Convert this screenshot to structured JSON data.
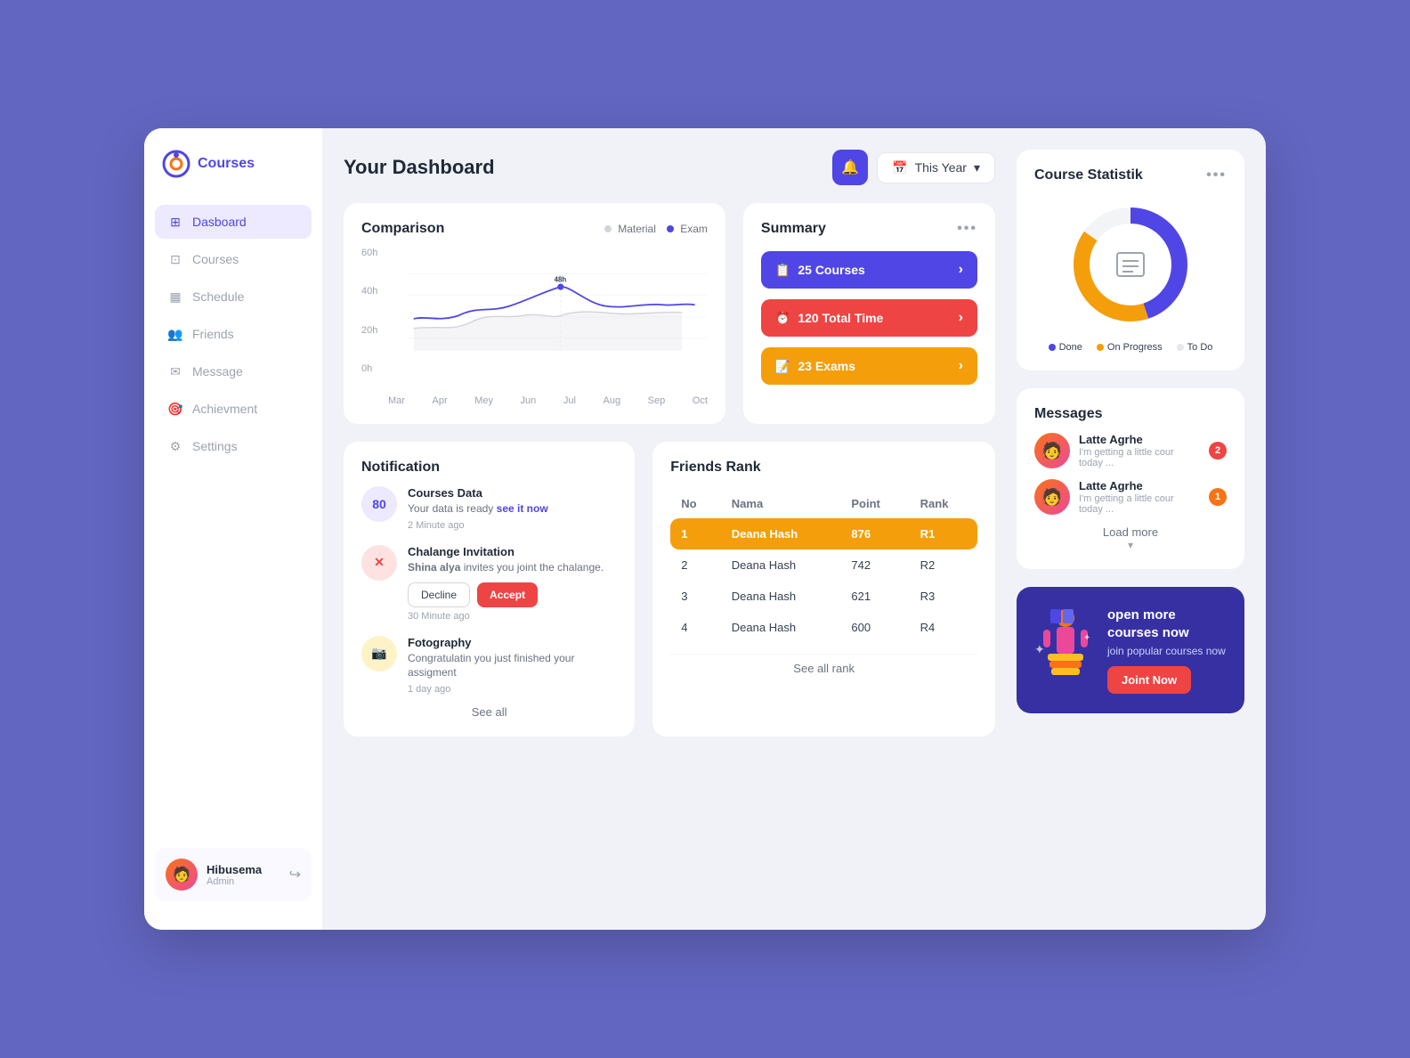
{
  "app": {
    "title": "Courses",
    "logo_alt": "Courses Logo"
  },
  "sidebar": {
    "items": [
      {
        "id": "dashboard",
        "label": "Dasboard",
        "icon": "⊞",
        "active": true
      },
      {
        "id": "courses",
        "label": "Courses",
        "icon": "⊡"
      },
      {
        "id": "schedule",
        "label": "Schedule",
        "icon": "📅"
      },
      {
        "id": "friends",
        "label": "Friends",
        "icon": "👥"
      },
      {
        "id": "message",
        "label": "Message",
        "icon": "✉"
      },
      {
        "id": "achievement",
        "label": "Achievment",
        "icon": "🏆"
      },
      {
        "id": "settings",
        "label": "Settings",
        "icon": "⚙"
      }
    ],
    "user": {
      "name": "Hibusema",
      "role": "Admin",
      "avatar": "👤"
    }
  },
  "header": {
    "title": "Your Dashboard",
    "period": "This Year",
    "notif_icon": "🔔",
    "calendar_icon": "📅"
  },
  "comparison_chart": {
    "title": "Comparison",
    "legend_material": "Material",
    "legend_exam": "Exam",
    "y_labels": [
      "60h",
      "40h",
      "20h",
      "0h"
    ],
    "x_labels": [
      "Mar",
      "Apr",
      "Mey",
      "Jun",
      "Jul",
      "Aug",
      "Sep",
      "Oct"
    ],
    "peak_label": "48h"
  },
  "summary": {
    "title": "Summary",
    "items": [
      {
        "label": "25 Courses",
        "icon": "📋",
        "color": "blue"
      },
      {
        "label": "120 Total Time",
        "icon": "⏰",
        "color": "red"
      },
      {
        "label": "23 Exams",
        "icon": "📝",
        "color": "yellow"
      }
    ]
  },
  "course_statistik": {
    "title": "Course Statistik",
    "legend": [
      {
        "label": "Done",
        "color": "#4f46e5"
      },
      {
        "label": "On Progress",
        "color": "#f59e0b"
      },
      {
        "label": "To Do",
        "color": "#e5e7eb"
      }
    ],
    "donut": {
      "done_pct": 45,
      "progress_pct": 40,
      "todo_pct": 15
    }
  },
  "notifications": {
    "title": "Notification",
    "items": [
      {
        "id": "courses-data",
        "icon": "80",
        "icon_type": "purple",
        "title": "Courses Data",
        "desc": "Your data is ready",
        "link_text": "see it now",
        "time": "2 Minute ago",
        "has_actions": false
      },
      {
        "id": "chalange",
        "icon": "✕",
        "icon_type": "red",
        "title": "Chalange Invitation",
        "desc": "Shina alya invites you joint the chalange.",
        "time": "30 Minute ago",
        "has_actions": true,
        "decline_label": "Decline",
        "accept_label": "Accept"
      },
      {
        "id": "photography",
        "icon": "📷",
        "icon_type": "yellow",
        "title": "Fotography",
        "desc": "Congratulatin you just finished your assigment",
        "time": "1 day ago",
        "has_actions": false
      }
    ],
    "see_all": "See all"
  },
  "friends_rank": {
    "title": "Friends Rank",
    "columns": [
      "No",
      "Nama",
      "Point",
      "Rank"
    ],
    "rows": [
      {
        "no": "1",
        "name": "Deana Hash",
        "point": "876",
        "rank": "R1",
        "highlighted": true
      },
      {
        "no": "2",
        "name": "Deana Hash",
        "point": "742",
        "rank": "R2",
        "highlighted": false
      },
      {
        "no": "3",
        "name": "Deana Hash",
        "point": "621",
        "rank": "R3",
        "highlighted": false
      },
      {
        "no": "4",
        "name": "Deana Hash",
        "point": "600",
        "rank": "R4",
        "highlighted": false
      }
    ],
    "see_all": "See all rank"
  },
  "messages": {
    "title": "Messages",
    "items": [
      {
        "name": "Latte Agrhe",
        "preview": "I'm getting a little cour today ...",
        "badge": "2",
        "badge_type": "red"
      },
      {
        "name": "Latte Agrhe",
        "preview": "I'm getting a little cour today ...",
        "badge": "1",
        "badge_type": "orange"
      }
    ],
    "load_more": "Load more"
  },
  "promo": {
    "title": "open more courses now",
    "subtitle": "join popular courses now",
    "cta": "Joint Now"
  }
}
